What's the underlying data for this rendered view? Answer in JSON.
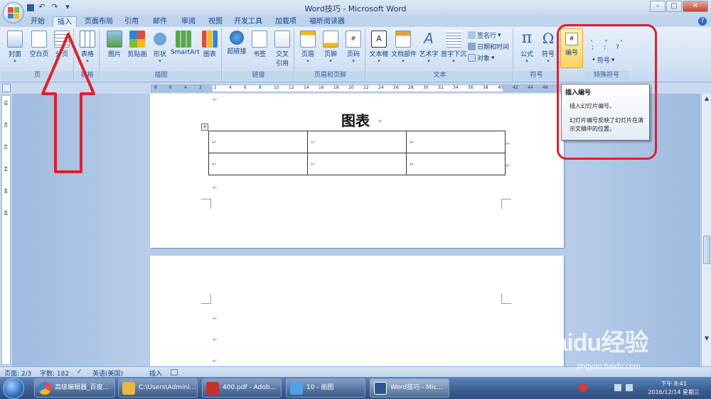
{
  "window": {
    "title": "Word技巧 - Microsoft Word",
    "controls": [
      "–",
      "□",
      "✕"
    ]
  },
  "quick_access": {
    "undo_glyph": "↶",
    "redo_glyph": "↷",
    "save_glyph": "▪",
    "more_glyph": "▾"
  },
  "tabs": [
    {
      "label": "开始"
    },
    {
      "label": "插入"
    },
    {
      "label": "页面布局"
    },
    {
      "label": "引用"
    },
    {
      "label": "邮件"
    },
    {
      "label": "审阅"
    },
    {
      "label": "视图"
    },
    {
      "label": "开发工具"
    },
    {
      "label": "加载项"
    },
    {
      "label": "福昕阅读器"
    }
  ],
  "help_glyph": "?",
  "ribbon": {
    "groups": {
      "page": "页",
      "table": "表格",
      "illustrations": "插图",
      "links": "链接",
      "header_footer": "页眉和页脚",
      "text": "文本",
      "symbols": "符号",
      "special_symbols": "特殊符号"
    },
    "buttons": {
      "cover": "封面",
      "blank_page": "空白页",
      "page_break": "分页",
      "table": "表格",
      "picture": "图片",
      "clipart": "剪贴画",
      "shapes": "形状",
      "smartart": "SmartArt",
      "chart": "图表",
      "hyperlink": "超链接",
      "bookmark": "书签",
      "cross_ref_1": "交叉",
      "cross_ref_2": "引用",
      "header": "页眉",
      "footer": "页脚",
      "page_number": "页码",
      "textbox": "文本框",
      "quickparts": "文档部件",
      "wordart": "艺术字",
      "dropcap": "首字下沉",
      "signature": "签名行",
      "datetime": "日期和时间",
      "object": "对象",
      "equation": "公式",
      "symbol": "符号",
      "numbering": "编号",
      "special_symbol": "符号"
    },
    "special_chars": [
      "、",
      "。",
      "、",
      ";",
      ":",
      "?"
    ],
    "dropdown_glyph": "▾",
    "numbering_icon_text": "#"
  },
  "tooltip": {
    "title": "插入编号",
    "line1": "插入幻灯片编号。",
    "line2": "幻灯片编号反映了幻灯片在演示文稿中的位置。"
  },
  "ruler": {
    "ticks": [
      "8",
      "6",
      "4",
      "2",
      "2",
      "4",
      "6",
      "8",
      "10",
      "12",
      "14",
      "16",
      "18",
      "20",
      "22",
      "24",
      "26",
      "28",
      "30",
      "32",
      "34",
      "36",
      "38",
      "40",
      "42",
      "44",
      "46"
    ],
    "vticks": [
      "38",
      "40",
      "42",
      "44",
      "46",
      "48"
    ]
  },
  "document": {
    "heading": "图表",
    "para_mark": "↵",
    "table_rows": [
      [
        "↵",
        "↵",
        "↵"
      ],
      [
        "↵",
        "↵",
        "↵"
      ]
    ],
    "table_handle": "+"
  },
  "statusbar": {
    "page": "页面: 2/3",
    "words": "字数: 182",
    "language": "英语(美国)",
    "mode": "插入"
  },
  "taskbar": {
    "items": [
      {
        "label": "高级编辑器_百度...",
        "color": "#e94b3c"
      },
      {
        "label": "C:\\Users\\Admini...",
        "color": "#e9b840"
      },
      {
        "label": "400.pdf - Adob...",
        "color": "#c9302c"
      },
      {
        "label": "10 - 画图",
        "color": "#4fa3e0"
      },
      {
        "label": "Word技巧 - Mic...",
        "color": "#2b5797"
      }
    ],
    "clock_time": "下午 8:41",
    "clock_date": "2016/12/14 星期三"
  },
  "watermark": {
    "brand": "Baidu经验",
    "url": "jingyan.baidu.com"
  },
  "colors": {
    "accent": "#15428b",
    "annotation_red": "#e31e2a",
    "highlight": "#ffd35c"
  }
}
